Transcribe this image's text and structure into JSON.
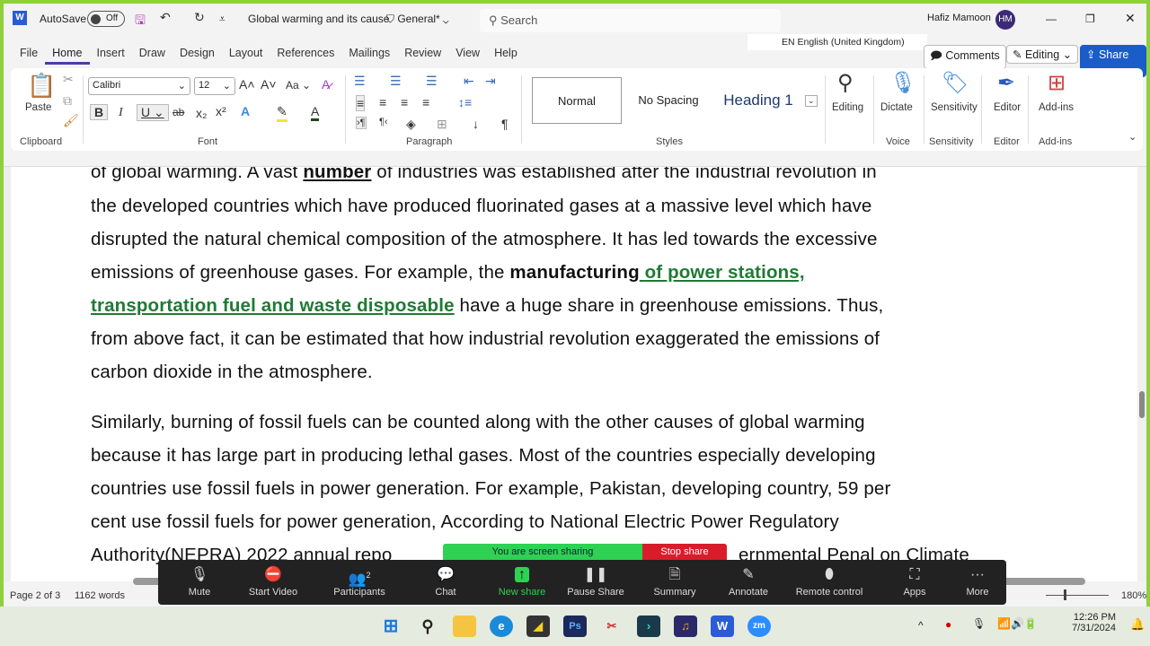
{
  "titlebar": {
    "autosave_label": "AutoSave",
    "autosave_state": "Off",
    "doc_title": "Global warming and its cause",
    "sensitivity": "General*",
    "search_placeholder": "Search",
    "user_name": "Hafiz Mamoon",
    "user_initials": "HM",
    "language_tip": "EN English (United Kingdom)"
  },
  "tabs": [
    "File",
    "Home",
    "Insert",
    "Draw",
    "Design",
    "Layout",
    "References",
    "Mailings",
    "Review",
    "View",
    "Help"
  ],
  "actions": {
    "comments": "Comments",
    "editing": "Editing",
    "share": "Share"
  },
  "ribbon": {
    "clipboard": {
      "paste": "Paste",
      "label": "Clipboard"
    },
    "font": {
      "name": "Calibri",
      "size": "12",
      "label": "Font",
      "case": "Aa"
    },
    "paragraph": {
      "label": "Paragraph"
    },
    "styles": {
      "items": [
        "Normal",
        "No Spacing",
        "Heading 1"
      ],
      "label": "Styles"
    },
    "editing": {
      "label": "Editing"
    },
    "voice": {
      "button": "Dictate",
      "label": "Voice"
    },
    "sensitivity": {
      "button": "Sensitivity",
      "label": "Sensitivity"
    },
    "editor": {
      "button": "Editor",
      "label": "Editor"
    },
    "addins": {
      "button": "Add-ins",
      "label": "Add-ins"
    }
  },
  "document": {
    "p1": [
      [
        "of global warming. A vast ",
        "number",
        " of industries was established after the industrial revolution in"
      ],
      "the developed countries which have produced fluorinated gases at a massive level which have",
      "disrupted the natural chemical composition of the atmosphere. It has led towards the excessive",
      [
        "emissions of greenhouse gases. For example, the ",
        "manufacturing",
        " of power stations,"
      ],
      [
        "transportation fuel and waste disposable",
        " have a huge share in greenhouse emissions. Thus,"
      ],
      "from above fact, it can be estimated that how industrial revolution exaggerated the emissions of",
      "carbon dioxide in the atmosphere."
    ],
    "p2": [
      "Similarly, burning of fossil fuels can be counted along with the other causes of global warming",
      "because  it has large part in producing  lethal gases. Most of the countries especially developing",
      "countries use fossil fuels in power generation. For example, Pakistan, developing country, 59 per",
      "cent use fossil fuels for power generation, According to National Electric Power Regulatory",
      "Authority(NEPRA) 2022 annual repo",
      "ernmental  Penal on Climate"
    ]
  },
  "status": {
    "page": "Page 2 of 3",
    "words": "1162 words",
    "zoom": "180%"
  },
  "zoom_meeting": {
    "sharing": "You are screen sharing",
    "stop": "Stop share",
    "participants_count": "2",
    "buttons": [
      "Mute",
      "Start Video",
      "Participants",
      "Chat",
      "New share",
      "Pause Share",
      "Summary",
      "Annotate",
      "Remote control",
      "Apps",
      "More"
    ]
  },
  "taskbar": {
    "time": "12:26 PM",
    "date": "7/31/2024"
  },
  "colors": {
    "accent": "#1a5dc8",
    "green_text": "#1f7a35",
    "frame": "#8fd13a",
    "zoom_green": "#2fd152",
    "zoom_red": "#d81c2a"
  }
}
